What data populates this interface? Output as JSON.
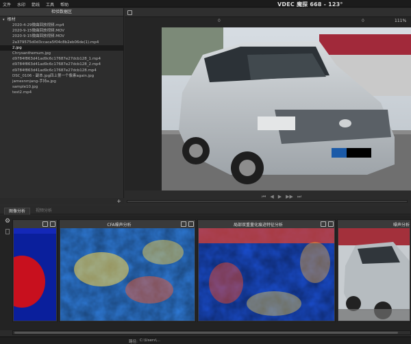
{
  "menu": [
    "文件",
    "水印",
    "箭线",
    "工具",
    "帮助"
  ],
  "app_title": "VDEC 魔探 668 - 123°",
  "file_panel": {
    "header": "检验数据区",
    "root": "根材",
    "files": [
      "2020-4-29微曲回放视频.mp4",
      "2020-9-15微曲回放视频.MOV",
      "2020-9-15微曲回放视频.MOV",
      "2a379575d0d3ccaca5f04c8b2eb06de(1).mp4",
      "2.jpg",
      "Chrysanthemum.jpg",
      "d9784f863d41ad9c6c17687e27dcb128_1.mp4",
      "d9784f863d41ad9c6c17687e27dcb128_2.mp4",
      "d9784f863d41ad9c6c17687e27dcb128.mp4",
      "DSC_0106 - 副本.jpg四上第一个像素again.jpg",
      "jamesnmjang-手持a.jpg",
      "sample10.jpg",
      "test2.mp4"
    ],
    "selected_index": 4,
    "add_label": "+"
  },
  "viewer": {
    "zoom_left": "0",
    "zoom_right": "0",
    "zoom_value": "111%",
    "controls": [
      "⏮",
      "◀",
      "▶",
      "▶▶",
      "⏭"
    ],
    "progress": 0
  },
  "tabs": [
    "图像分析",
    "视频分析"
  ],
  "cards": [
    {
      "title": ""
    },
    {
      "title": "CFA噪声分析"
    },
    {
      "title": "局部双重量化痕迹特征分析"
    },
    {
      "title": "噪声分析"
    }
  ],
  "status": {
    "label": "路径:",
    "value": "C:\\Users\\..."
  }
}
